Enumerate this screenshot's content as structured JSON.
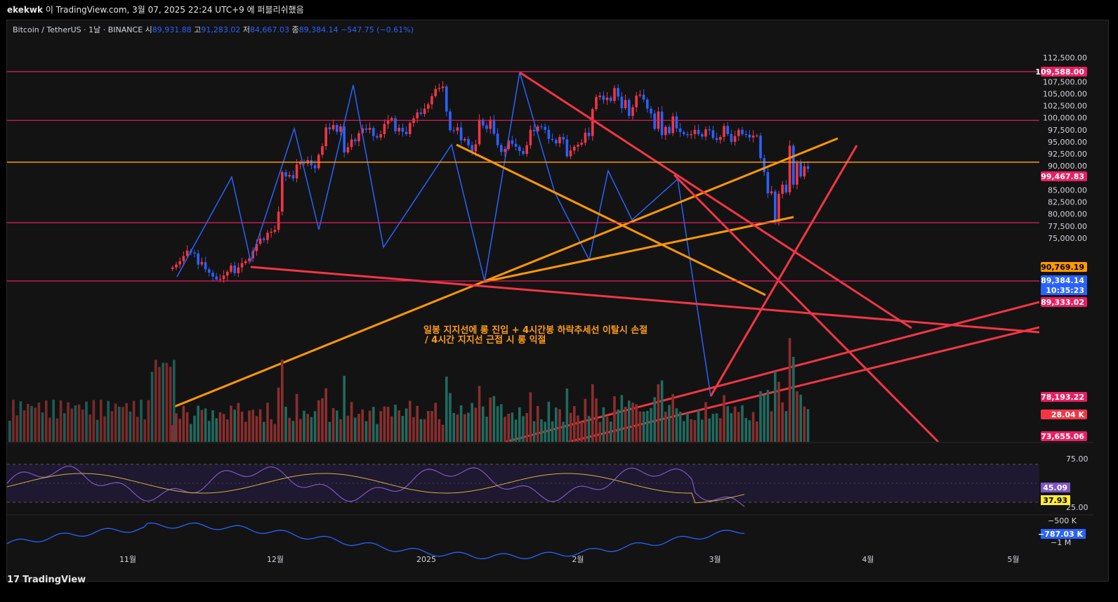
{
  "header": {
    "author": "ekekwk",
    "published": "이 TradingView.com, 3월 07, 2025 22:24 UTC+9 에 퍼블리쉬했음"
  },
  "legend": {
    "symbol": "Bitcoin / TetherUS · 1날 · BINANCE",
    "open_label": "시",
    "open": "89,931.88",
    "high_label": "고",
    "high": "91,283.02",
    "low_label": "저",
    "low": "84,667.03",
    "close_label": "종",
    "close": "89,384.14",
    "change": "−547.75 (−0.61%)"
  },
  "footer": {
    "brand": "TradingView",
    "logo": "17"
  },
  "colors": {
    "up": "#f23645",
    "down": "#089981",
    "blue_zig": "#2962ff",
    "orange": "#ff9800",
    "red_line": "#f23645",
    "pink_level": "#e91e63"
  },
  "chart_data": {
    "type": "candlestick",
    "symbol": "Bitcoin / TetherUS",
    "interval": "1날",
    "y_axis": {
      "ticks": [
        "112,500.00",
        "110,000.00",
        "107,500.00",
        "105,000.00",
        "102,500.00",
        "100,000.00",
        "97,500.00",
        "95,000.00",
        "92,500.00",
        "90,000.00",
        "87,500.00",
        "85,000.00",
        "82,500.00",
        "80,000.00",
        "77,500.00",
        "75,000.00"
      ],
      "range": [
        72500,
        114000
      ]
    },
    "x_axis": {
      "labels": [
        "11월",
        "12월",
        "2025",
        "2월",
        "3월",
        "4월",
        "5월"
      ]
    },
    "price_labels": [
      {
        "text": "109,588.00",
        "color": "#e91e63"
      },
      {
        "text": "99,467.83",
        "color": "#e91e63"
      },
      {
        "text": "90,769.19",
        "color": "#ff9800"
      },
      {
        "text": "89,384.14",
        "color": "#2962ff"
      },
      {
        "text": "10:35:23",
        "color": "#2962ff"
      },
      {
        "text": "89,333.02",
        "color": "#e91e63"
      },
      {
        "text": "78,193.22",
        "color": "#e91e63"
      },
      {
        "text": "28.04 K",
        "color": "#f23645"
      },
      {
        "text": "73,655.06",
        "color": "#e91e63"
      }
    ],
    "horizontal_levels": [
      109588,
      99467.83,
      90769.19,
      89333.02,
      78193.22
    ],
    "annotation": [
      "일봉 지지선에 롱 진입 + 4시간봉 하락추세선 이탈시 손절",
      "/ 4시간 지지선 근접 시 롱 익절"
    ],
    "rsi": {
      "ticks": [
        "75.00",
        "25.00"
      ],
      "labels": [
        {
          "text": "45.09",
          "color": "#7e57c2"
        },
        {
          "text": "37.93",
          "color": "#ffeb3b"
        }
      ]
    },
    "obv": {
      "ticks": [
        "−500 K",
        "−1 M"
      ],
      "labels": [
        {
          "text": "−787.03 K",
          "color": "#2962ff"
        }
      ]
    },
    "closes": [
      68900,
      69500,
      70200,
      71300,
      72400,
      72000,
      71800,
      69500,
      70000,
      68500,
      67800,
      67000,
      66400,
      66500,
      67200,
      68000,
      69300,
      67700,
      68900,
      69800,
      70200,
      70800,
      72300,
      73800,
      74900,
      74600,
      76100,
      76300,
      76700,
      80500,
      88700,
      87800,
      88100,
      87400,
      90300,
      90800,
      90500,
      91200,
      90100,
      89500,
      92300,
      94100,
      98000,
      97600,
      98500,
      97100,
      98200,
      92800,
      93900,
      95500,
      95100,
      96800,
      97800,
      97500,
      97900,
      96200,
      95900,
      96600,
      98700,
      99500,
      99900,
      97200,
      97900,
      97100,
      96600,
      98900,
      99900,
      101100,
      100800,
      101900,
      102800,
      104500,
      106000,
      106200,
      106500,
      101300,
      97400,
      97300,
      98000,
      95300,
      95600,
      94300,
      93000,
      94500,
      99600,
      98400,
      97700,
      99600,
      96700,
      94300,
      92900,
      93500,
      95300,
      94600,
      94000,
      93100,
      92500,
      94300,
      97500,
      97200,
      98200,
      98100,
      97500,
      95600,
      95400,
      94700,
      96000,
      95500,
      92000,
      93200,
      94000,
      94400,
      94800,
      96900,
      96200,
      101800,
      104300,
      104600,
      103700,
      104200,
      103500,
      106200,
      104400,
      102000,
      103700,
      100400,
      102200,
      104600,
      104800,
      103800,
      101900,
      100900,
      97700,
      101300,
      96400,
      98100,
      96800,
      100300,
      97800,
      97000,
      96600,
      96400,
      96600,
      97500,
      96600,
      96100,
      97600,
      97400,
      95800,
      95400,
      96000,
      98300,
      96600,
      95000,
      96200,
      97500,
      96600,
      96500,
      95900,
      96300,
      96300,
      91600,
      88700,
      84300,
      84700,
      78400,
      84200,
      86100,
      84500,
      94200,
      86100,
      90600,
      87800,
      89900,
      89400
    ]
  }
}
